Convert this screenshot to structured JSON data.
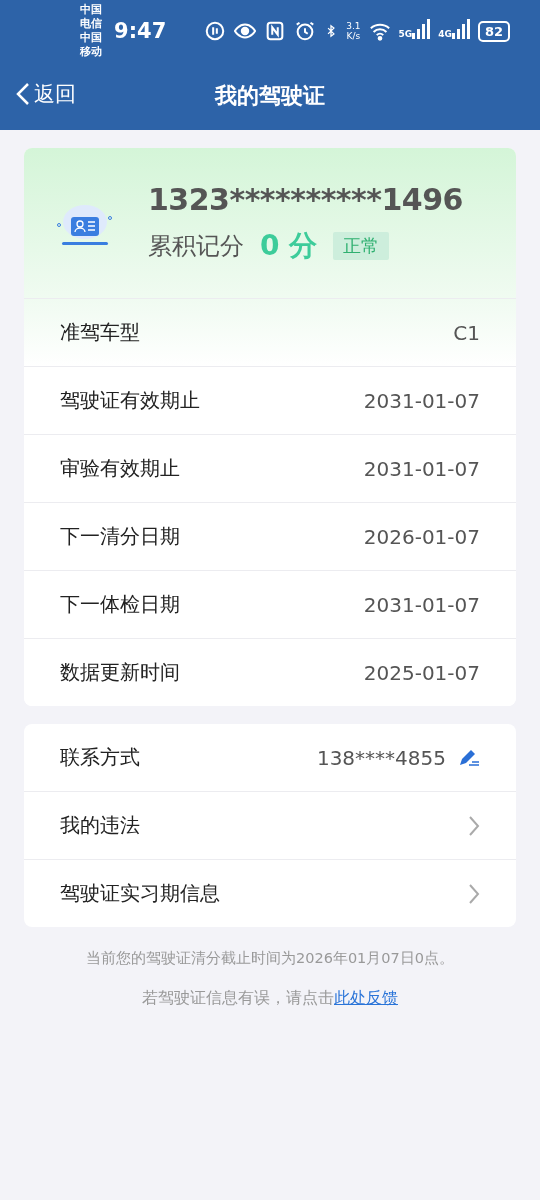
{
  "status_bar": {
    "carriers": [
      "中国电信",
      "中国移动"
    ],
    "time": "9:47",
    "speed_value": "3.1",
    "speed_unit": "K/s",
    "networks": [
      "5G",
      "4G"
    ],
    "battery": "82"
  },
  "nav": {
    "back": "返回",
    "title": "我的驾驶证"
  },
  "license": {
    "number": "1323**********1496",
    "points_label": "累积记分",
    "points": "0",
    "points_unit": "分",
    "status": "正常"
  },
  "details": [
    {
      "label": "准驾车型",
      "value": "C1"
    },
    {
      "label": "驾驶证有效期止",
      "value": "2031-01-07"
    },
    {
      "label": "审验有效期止",
      "value": "2031-01-07"
    },
    {
      "label": "下一清分日期",
      "value": "2026-01-07"
    },
    {
      "label": "下一体检日期",
      "value": "2031-01-07"
    },
    {
      "label": "数据更新时间",
      "value": "2025-01-07"
    }
  ],
  "actions": [
    {
      "kind": "edit",
      "label": "联系方式",
      "value": "138****4855"
    },
    {
      "kind": "link",
      "label": "我的违法"
    },
    {
      "kind": "link",
      "label": "驾驶证实习期信息"
    }
  ],
  "notice": "当前您的驾驶证清分截止时间为2026年01月07日0点。",
  "feedback": {
    "text": "若驾驶证信息有误，请点击",
    "link": "此处反馈"
  }
}
